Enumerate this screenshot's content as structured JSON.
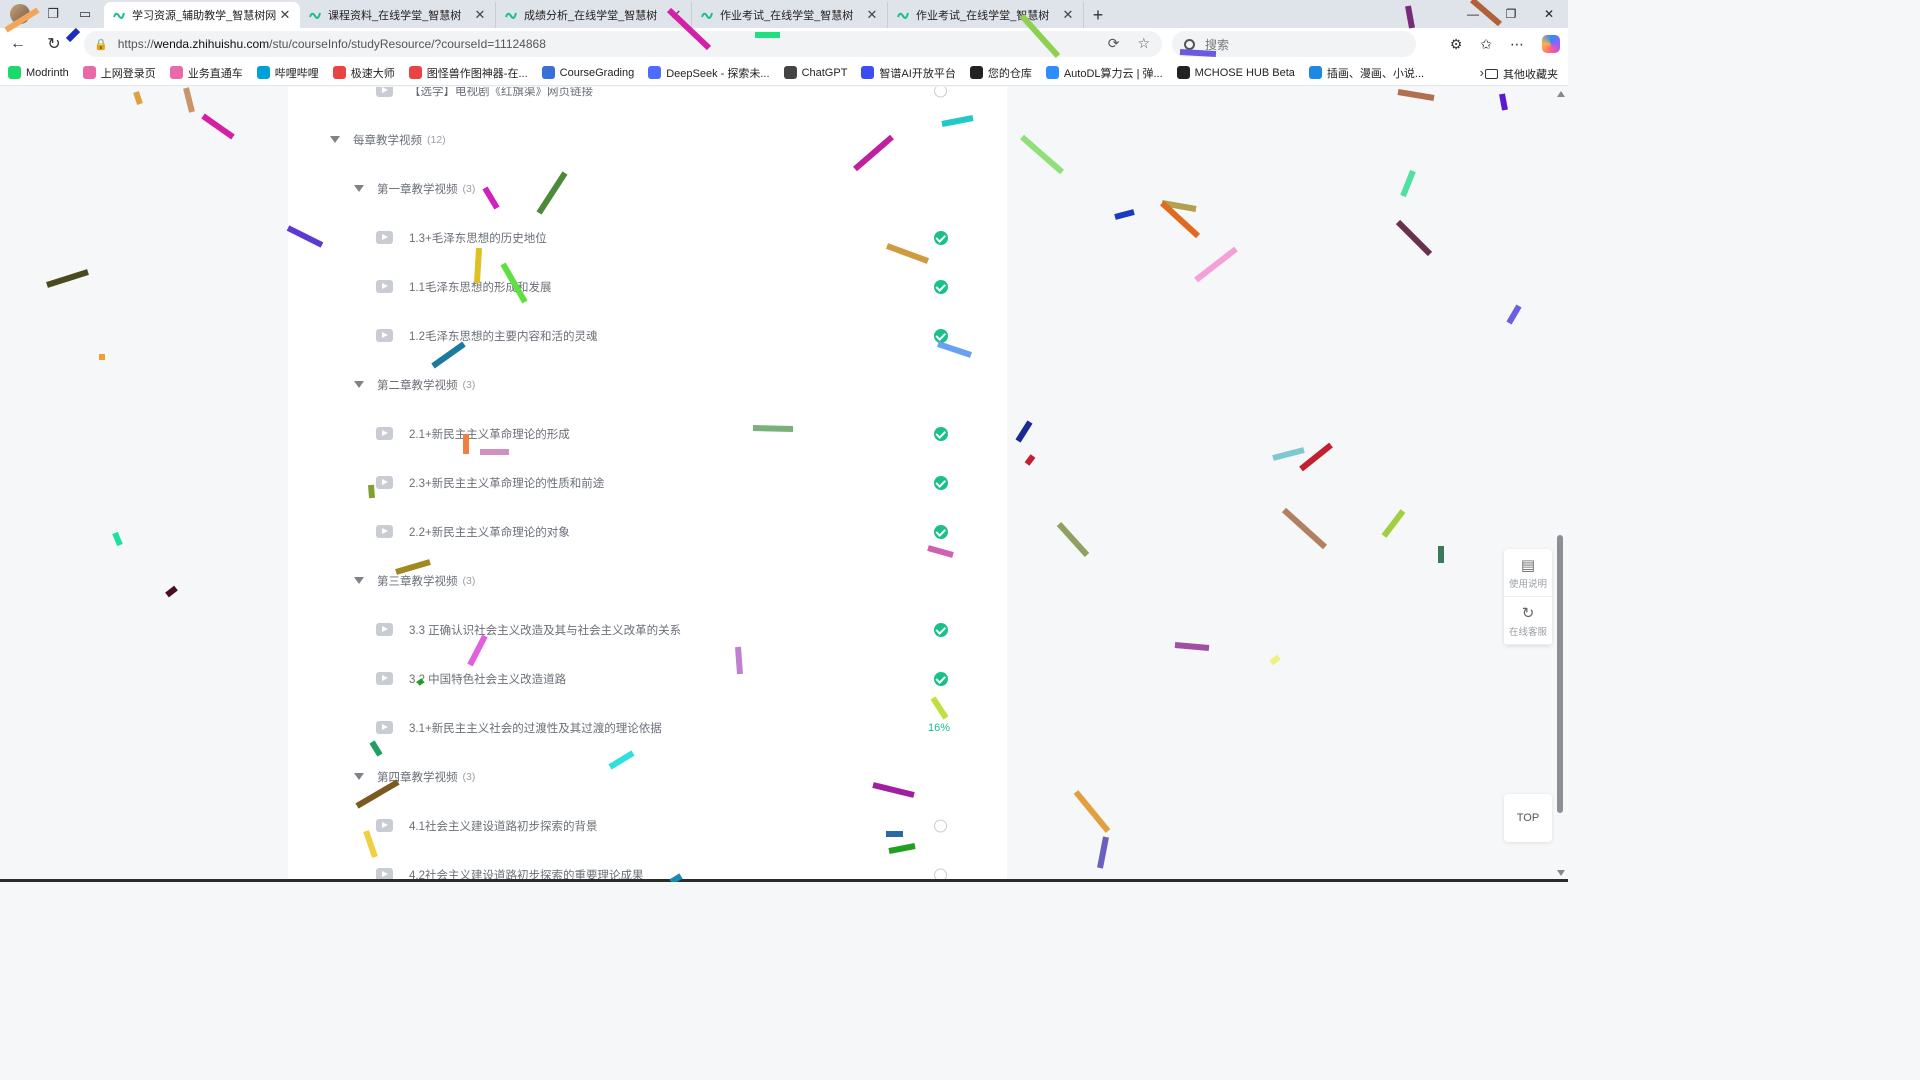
{
  "browser": {
    "tabs": [
      {
        "title": "学习资源_辅助教学_智慧树网",
        "active": true
      },
      {
        "title": "课程资料_在线学堂_智慧树",
        "active": false
      },
      {
        "title": "成绩分析_在线学堂_智慧树",
        "active": false
      },
      {
        "title": "作业考试_在线学堂_智慧树",
        "active": false
      },
      {
        "title": "作业考试_在线学堂_智慧树",
        "active": false
      }
    ],
    "new_tab_label": "+",
    "url_prefix": "https://",
    "url_host": "wenda.zhihuishu.com",
    "url_path": "/stu/courseInfo/studyResource/?courseId=11124868",
    "search_placeholder": "搜索"
  },
  "bookmarks": [
    {
      "label": "Modrinth",
      "color": "#1bd96a"
    },
    {
      "label": "上网登录页",
      "color": "#e86aa8"
    },
    {
      "label": "业务直通车",
      "color": "#e86aa8"
    },
    {
      "label": "哔哩哔哩",
      "color": "#00a1d6"
    },
    {
      "label": "极速大师",
      "color": "#e94444"
    },
    {
      "label": "图怪兽作图神器-在...",
      "color": "#e94444"
    },
    {
      "label": "CourseGrading",
      "color": "#3b6fd8"
    },
    {
      "label": "DeepSeek - 探索未...",
      "color": "#4d6bfe"
    },
    {
      "label": "ChatGPT",
      "color": "#444444"
    },
    {
      "label": "智谱AI开放平台",
      "color": "#3b4cf0"
    },
    {
      "label": "您的仓库",
      "color": "#222222"
    },
    {
      "label": "AutoDL算力云 | 弹...",
      "color": "#2f8cff"
    },
    {
      "label": "MCHOSE HUB Beta",
      "color": "#222222"
    },
    {
      "label": "插画、漫画、小说...",
      "color": "#1e88e5"
    }
  ],
  "bookmarks_other": "其他收藏夹",
  "course": {
    "partial_top_item": "【选学】电视剧《红旗渠》网页链接",
    "section": {
      "title": "每章教学视频",
      "count": "(12)"
    },
    "chapters": [
      {
        "title": "第一章教学视频",
        "count": "(3)",
        "videos": [
          {
            "title": "1.3+毛泽东思想的历史地位",
            "status": "done"
          },
          {
            "title": "1.1毛泽东思想的形成和发展",
            "status": "done"
          },
          {
            "title": "1.2毛泽东思想的主要内容和活的灵魂",
            "status": "done"
          }
        ]
      },
      {
        "title": "第二章教学视频",
        "count": "(3)",
        "videos": [
          {
            "title": "2.1+新民主主义革命理论的形成",
            "status": "done"
          },
          {
            "title": "2.3+新民主主义革命理论的性质和前途",
            "status": "done"
          },
          {
            "title": "2.2+新民主主义革命理论的对象",
            "status": "done"
          }
        ]
      },
      {
        "title": "第三章教学视频",
        "count": "(3)",
        "videos": [
          {
            "title": "3.3 正确认识社会主义改造及其与社会主义改革的关系",
            "status": "done"
          },
          {
            "title": "3.2 中国特色社会主义改造道路",
            "status": "done"
          },
          {
            "title": "3.1+新民主主义社会的过渡性及其过渡的理论依据",
            "status": "16%"
          }
        ]
      },
      {
        "title": "第四章教学视频",
        "count": "(3)",
        "videos": [
          {
            "title": "4.1社会主义建设道路初步探索的背景",
            "status": "empty"
          },
          {
            "title": "4.2社会主义建设道路初步探索的重要理论成果",
            "status": "empty"
          }
        ]
      }
    ]
  },
  "side_tools": {
    "guide": "使用说明",
    "service": "在线客服",
    "top": "TOP"
  }
}
